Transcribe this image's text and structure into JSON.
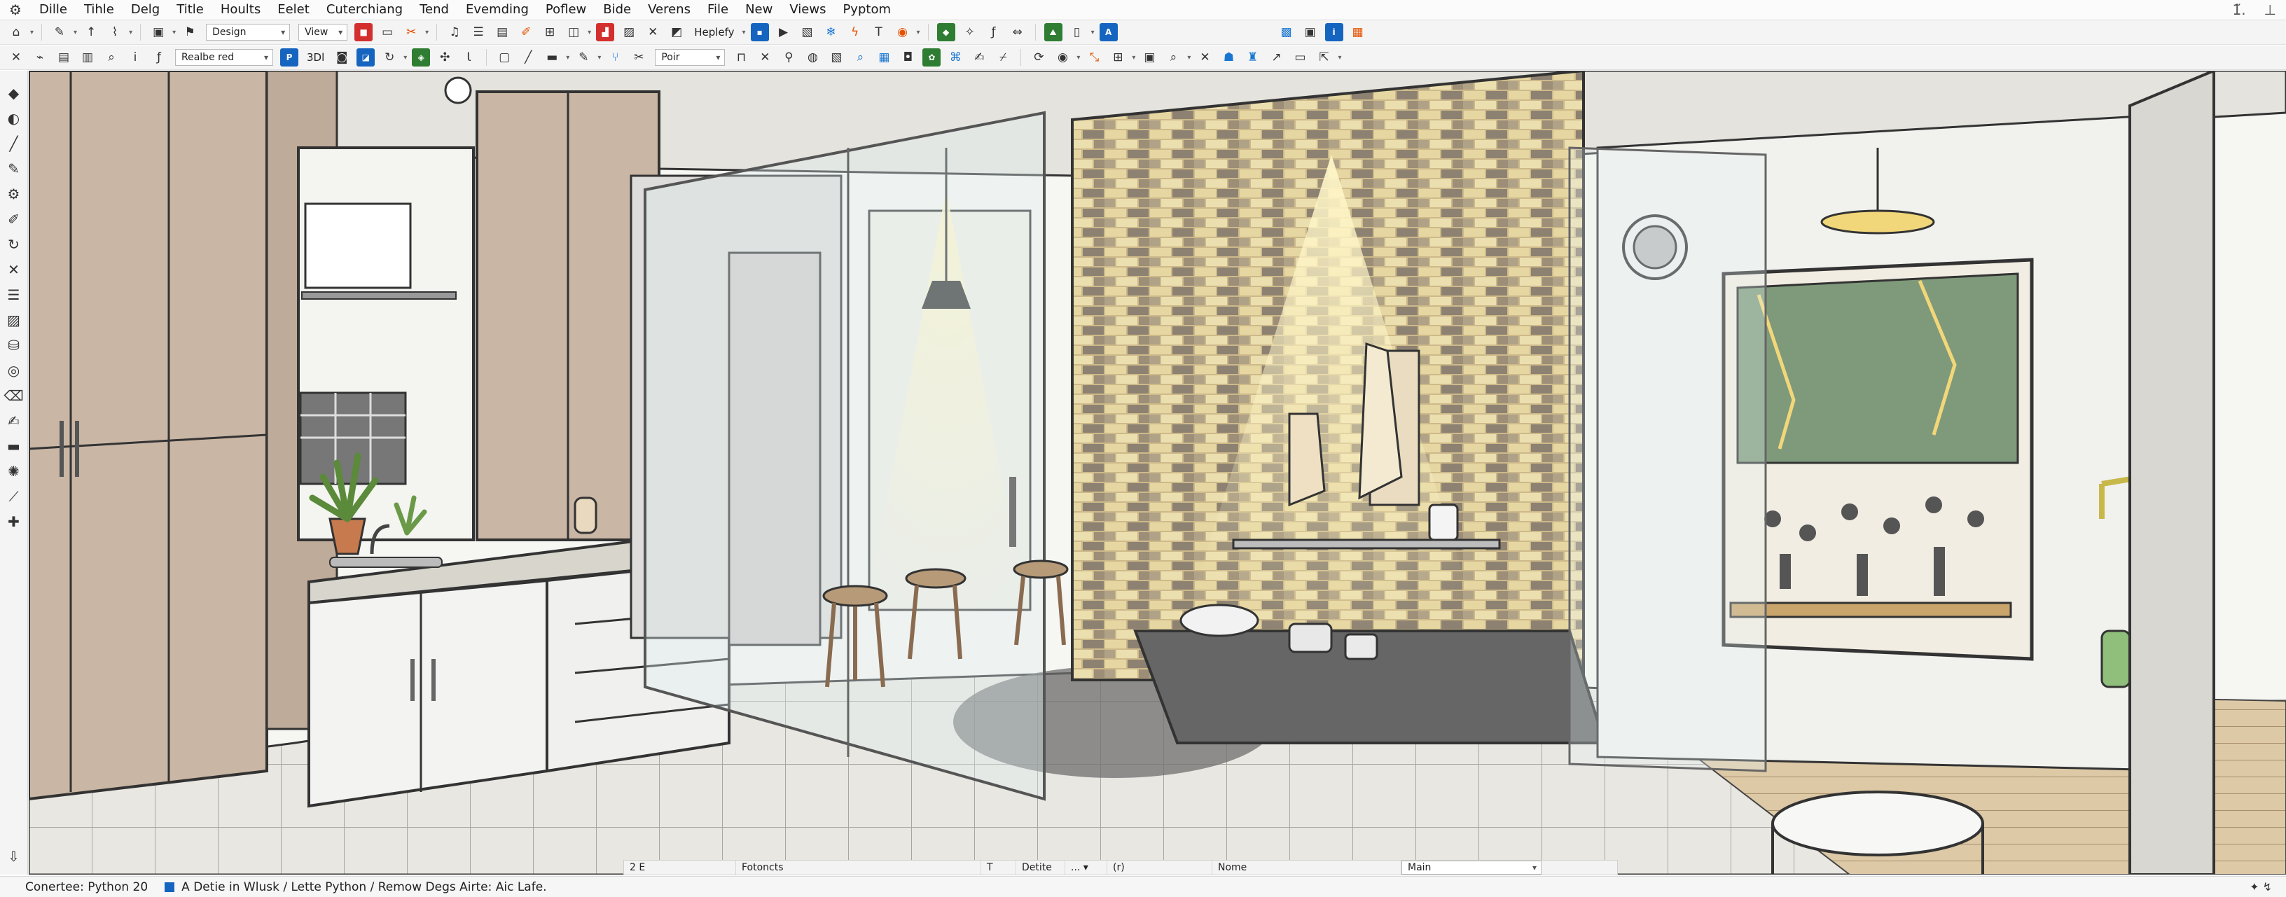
{
  "window": {
    "controls": [
      "1̃.",
      "⊥"
    ]
  },
  "menubar": {
    "app_icon": "⚙",
    "items": [
      "Dille",
      "Tihle",
      "Delg",
      "Title",
      "Hoults",
      "Eelet",
      "Cuterchiang",
      "Tend",
      "Evemding",
      "Poflew",
      "Bide",
      "Verens",
      "File",
      "New",
      "Views",
      "Pyptom"
    ]
  },
  "toolbar1": {
    "dropdown_style": "Design",
    "dropdown_view": "View",
    "label_heplefy": "Heplefy"
  },
  "toolbar2": {
    "dropdown_layer": "Realbe red",
    "label_3d": "3Dl",
    "dropdown_poin": "Poir"
  },
  "bottom_panel": {
    "cells": [
      "2 E",
      "Fotoncts",
      "T",
      "Detite",
      "... ▾",
      "(r)",
      "Nome",
      "Main"
    ]
  },
  "statusbar": {
    "left": "Conertee: Python 20",
    "message": "A  Detie in Wlusk  /  Lette Python  /  Remow Degs Airte: Aic  Lafe.",
    "right": "✦ ↯"
  },
  "colors": {
    "accent_blue": "#1565c0",
    "brick_light": "#d8c68f",
    "brick_dark": "#8a7d6a",
    "cabinet": "#c9b6a4",
    "chalkboard": "#7f9a7a",
    "lamp_glow": "#f2d77a"
  }
}
